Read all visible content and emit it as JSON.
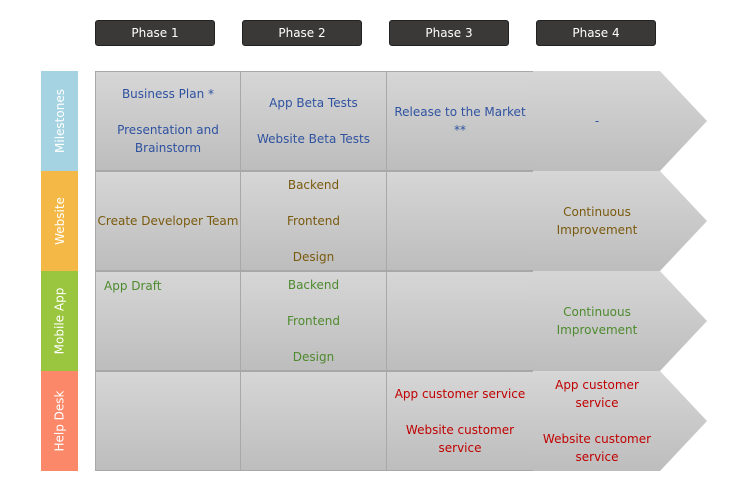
{
  "phases": [
    "Phase 1",
    "Phase 2",
    "Phase 3",
    "Phase 4"
  ],
  "rows": [
    {
      "label": "Milestones",
      "color": "#a5d3e1",
      "text_color": "#2f52a0",
      "cells": [
        [
          "Business Plan *",
          "Presentation and Brainstorm"
        ],
        [
          "App Beta Tests",
          "Website Beta Tests"
        ],
        [
          "Release to the Market **"
        ],
        [
          "-"
        ]
      ]
    },
    {
      "label": "Website",
      "color": "#f4b846",
      "text_color": "#7a5a0e",
      "cells": [
        [
          "Create Developer Team"
        ],
        [
          "Backend",
          "Frontend",
          "Design"
        ],
        [],
        [
          "Continuous Improvement"
        ]
      ]
    },
    {
      "label": "Mobile App",
      "color": "#9ac53e",
      "text_color": "#4e8a2e",
      "cells": [
        [
          "App Draft"
        ],
        [
          "Backend",
          "Frontend",
          "Design"
        ],
        [],
        [
          "Continuous Improvement"
        ]
      ]
    },
    {
      "label": "Help Desk",
      "color": "#fb8868",
      "text_color": "#c00000",
      "cells": [
        [],
        [],
        [
          "App customer service",
          "Website customer service"
        ],
        [
          "App customer service",
          "Website customer service"
        ]
      ]
    }
  ]
}
